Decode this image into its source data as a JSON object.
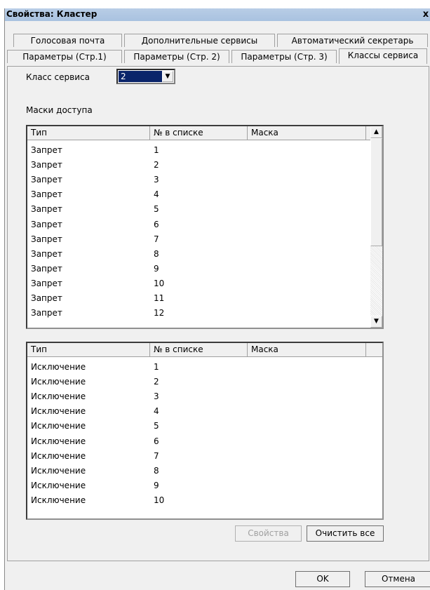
{
  "window": {
    "title": "Свойства: Кластер",
    "close": "x"
  },
  "tabs_row1": [
    "Голосовая почта",
    "Дополнительные сервисы",
    "Автоматический секретарь"
  ],
  "tabs_row2": [
    "Параметры (Стр.1)",
    "Параметры (Стр. 2)",
    "Параметры (Стр. 3)",
    "Классы сервиса"
  ],
  "service_class": {
    "label": "Класс сервиса",
    "value": "2"
  },
  "access_masks_label": "Маски доступа",
  "table1": {
    "headers": [
      "Тип",
      "№ в списке",
      "Маска"
    ],
    "rows": [
      [
        "Запрет",
        "1",
        ""
      ],
      [
        "Запрет",
        "2",
        ""
      ],
      [
        "Запрет",
        "3",
        ""
      ],
      [
        "Запрет",
        "4",
        ""
      ],
      [
        "Запрет",
        "5",
        ""
      ],
      [
        "Запрет",
        "6",
        ""
      ],
      [
        "Запрет",
        "7",
        ""
      ],
      [
        "Запрет",
        "8",
        ""
      ],
      [
        "Запрет",
        "9",
        ""
      ],
      [
        "Запрет",
        "10",
        ""
      ],
      [
        "Запрет",
        "11",
        ""
      ],
      [
        "Запрет",
        "12",
        ""
      ]
    ]
  },
  "table2": {
    "headers": [
      "Тип",
      "№ в списке",
      "Маска"
    ],
    "rows": [
      [
        "Исключение",
        "1",
        ""
      ],
      [
        "Исключение",
        "2",
        ""
      ],
      [
        "Исключение",
        "3",
        ""
      ],
      [
        "Исключение",
        "4",
        ""
      ],
      [
        "Исключение",
        "5",
        ""
      ],
      [
        "Исключение",
        "6",
        ""
      ],
      [
        "Исключение",
        "7",
        ""
      ],
      [
        "Исключение",
        "8",
        ""
      ],
      [
        "Исключение",
        "9",
        ""
      ],
      [
        "Исключение",
        "10",
        ""
      ]
    ]
  },
  "buttons": {
    "properties": "Свойства",
    "clear_all": "Очистить все",
    "ok": "OK",
    "cancel": "Отмена"
  }
}
